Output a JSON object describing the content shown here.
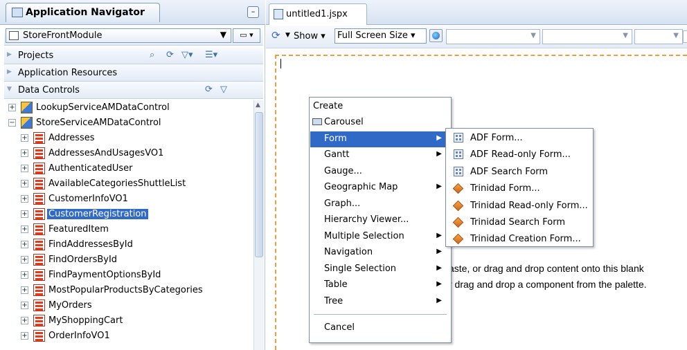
{
  "navigator": {
    "title": "Application Navigator",
    "module": "StoreFrontModule",
    "minimize_glyph": "–",
    "sections": {
      "projects": "Projects",
      "app_resources": "Application Resources",
      "data_controls": "Data Controls"
    },
    "tree": [
      {
        "label": "LookupServiceAMDataControl",
        "level": 0,
        "expander": "+",
        "icon": "data-control-icon"
      },
      {
        "label": "StoreServiceAMDataControl",
        "level": 0,
        "expander": "−",
        "icon": "data-control-icon"
      },
      {
        "label": "Addresses",
        "level": 1,
        "expander": "+",
        "icon": "collection-icon"
      },
      {
        "label": "AddressesAndUsagesVO1",
        "level": 1,
        "expander": "+",
        "icon": "collection-icon"
      },
      {
        "label": "AuthenticatedUser",
        "level": 1,
        "expander": "+",
        "icon": "collection-icon"
      },
      {
        "label": "AvailableCategoriesShuttleList",
        "level": 1,
        "expander": "+",
        "icon": "collection-icon"
      },
      {
        "label": "CustomerInfoVO1",
        "level": 1,
        "expander": "+",
        "icon": "collection-icon"
      },
      {
        "label": "CustomerRegistration",
        "level": 1,
        "expander": "+",
        "icon": "collection-icon",
        "selected": true
      },
      {
        "label": "FeaturedItem",
        "level": 1,
        "expander": "+",
        "icon": "collection-icon"
      },
      {
        "label": "FindAddressesById",
        "level": 1,
        "expander": "+",
        "icon": "collection-icon"
      },
      {
        "label": "FindOrdersById",
        "level": 1,
        "expander": "+",
        "icon": "collection-icon"
      },
      {
        "label": "FindPaymentOptionsById",
        "level": 1,
        "expander": "+",
        "icon": "collection-icon"
      },
      {
        "label": "MostPopularProductsByCategories",
        "level": 1,
        "expander": "+",
        "icon": "collection-icon"
      },
      {
        "label": "MyOrders",
        "level": 1,
        "expander": "+",
        "icon": "collection-icon"
      },
      {
        "label": "MyShoppingCart",
        "level": 1,
        "expander": "+",
        "icon": "collection-icon"
      },
      {
        "label": "OrderInfoVO1",
        "level": 1,
        "expander": "+",
        "icon": "collection-icon"
      }
    ]
  },
  "editor": {
    "file_tab": "untitled1.jspx",
    "toolbar": {
      "show_label": "Show ▾",
      "screen_size": "Full Screen Size ▾"
    },
    "canvas_msg_line1": "aste, or drag and drop content onto this blank",
    "canvas_msg_line2": "r drag and drop a component from the palette."
  },
  "context_menu": {
    "header": "Create",
    "items": [
      {
        "label": "Carousel",
        "submenu": false
      },
      {
        "label": "Form",
        "submenu": true,
        "highlighted": true
      },
      {
        "label": "Gantt",
        "submenu": true
      },
      {
        "label": "Gauge...",
        "submenu": false
      },
      {
        "label": "Geographic Map",
        "submenu": true
      },
      {
        "label": "Graph...",
        "submenu": false
      },
      {
        "label": "Hierarchy Viewer...",
        "submenu": false
      },
      {
        "label": "Multiple Selection",
        "submenu": true
      },
      {
        "label": "Navigation",
        "submenu": true
      },
      {
        "label": "Single Selection",
        "submenu": true
      },
      {
        "label": "Table",
        "submenu": true
      },
      {
        "label": "Tree",
        "submenu": true
      }
    ],
    "cancel": "Cancel",
    "submenu_glyph": "▶"
  },
  "form_submenu": [
    {
      "label": "ADF Form...",
      "icon": "adf-form-icon"
    },
    {
      "label": "ADF Read-only Form...",
      "icon": "adf-form-icon"
    },
    {
      "label": "ADF Search Form",
      "icon": "adf-form-icon"
    },
    {
      "label": "Trinidad Form...",
      "icon": "trinidad-icon"
    },
    {
      "label": "Trinidad Read-only Form...",
      "icon": "trinidad-icon"
    },
    {
      "label": "Trinidad Search Form",
      "icon": "trinidad-icon"
    },
    {
      "label": "Trinidad Creation Form...",
      "icon": "trinidad-icon"
    }
  ],
  "colors": {
    "selection": "#3169c6",
    "canvas_border": "#f29d3a"
  }
}
